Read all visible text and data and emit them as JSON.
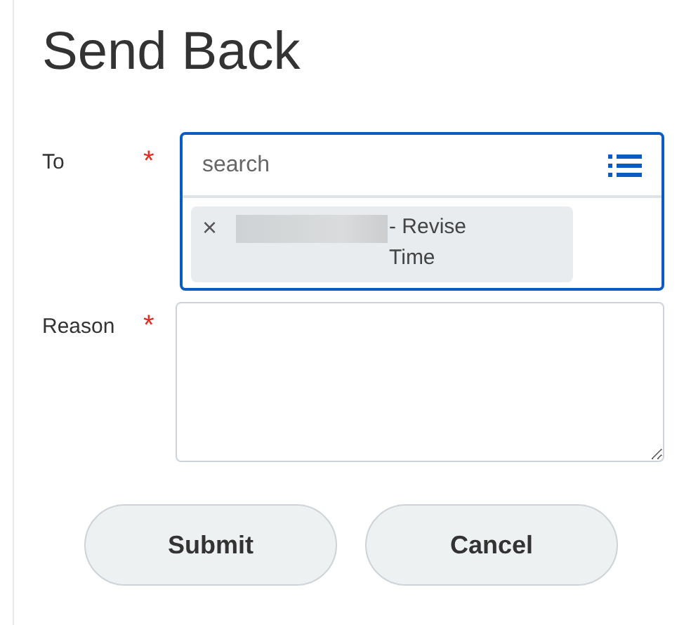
{
  "title": "Send Back",
  "to_field": {
    "label": "To",
    "required": true,
    "placeholder": "search",
    "focused": true,
    "tokens": [
      {
        "remove": "×",
        "text": "- Revise Time"
      }
    ]
  },
  "reason_field": {
    "label": "Reason",
    "required": true
  },
  "required_mark": "*",
  "buttons": [
    {
      "label": "Submit"
    },
    {
      "label": "Cancel"
    }
  ]
}
